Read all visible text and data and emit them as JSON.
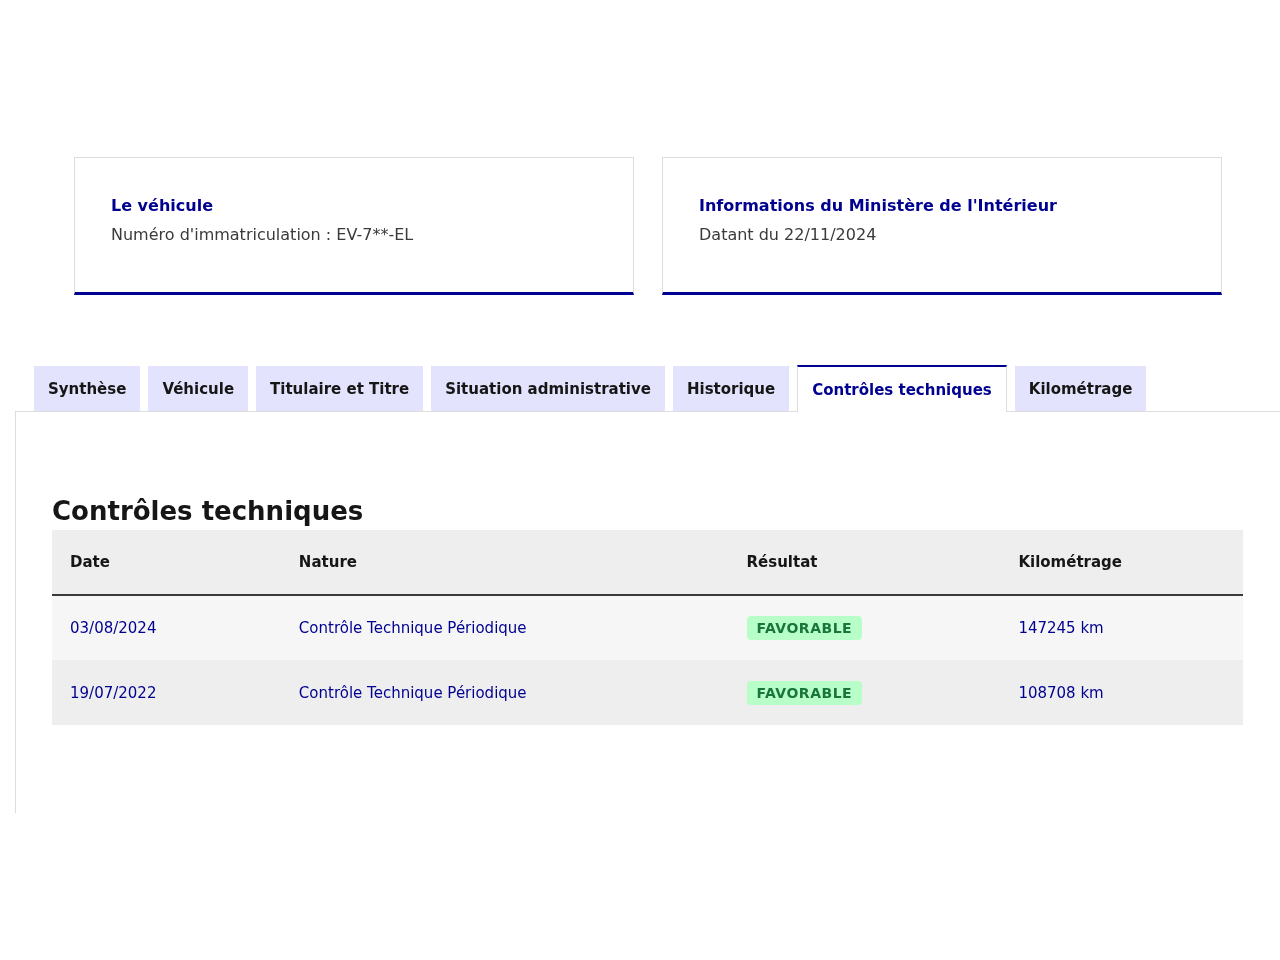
{
  "cards": [
    {
      "title": "Le véhicule",
      "text": "Numéro d'immatriculation : EV-7**-EL"
    },
    {
      "title": "Informations du Ministère de l'Intérieur",
      "text": "Datant du 22/11/2024"
    }
  ],
  "tabs": [
    {
      "label": "Synthèse",
      "selected": false
    },
    {
      "label": "Véhicule",
      "selected": false
    },
    {
      "label": "Titulaire et Titre",
      "selected": false
    },
    {
      "label": "Situation administrative",
      "selected": false
    },
    {
      "label": "Historique",
      "selected": false
    },
    {
      "label": "Contrôles techniques",
      "selected": true
    },
    {
      "label": "Kilométrage",
      "selected": false
    }
  ],
  "section": {
    "title": "Contrôles techniques",
    "table": {
      "columns": [
        "Date",
        "Nature",
        "Résultat",
        "Kilométrage"
      ],
      "rows": [
        {
          "date": "03/08/2024",
          "nature": "Contrôle Technique Périodique",
          "result": {
            "label": "FAVORABLE",
            "kind": "success"
          },
          "mileage": "147245 km"
        },
        {
          "date": "19/07/2022",
          "nature": "Contrôle Technique Périodique",
          "result": {
            "label": "FAVORABLE",
            "kind": "success"
          },
          "mileage": "108708 km"
        }
      ]
    }
  }
}
